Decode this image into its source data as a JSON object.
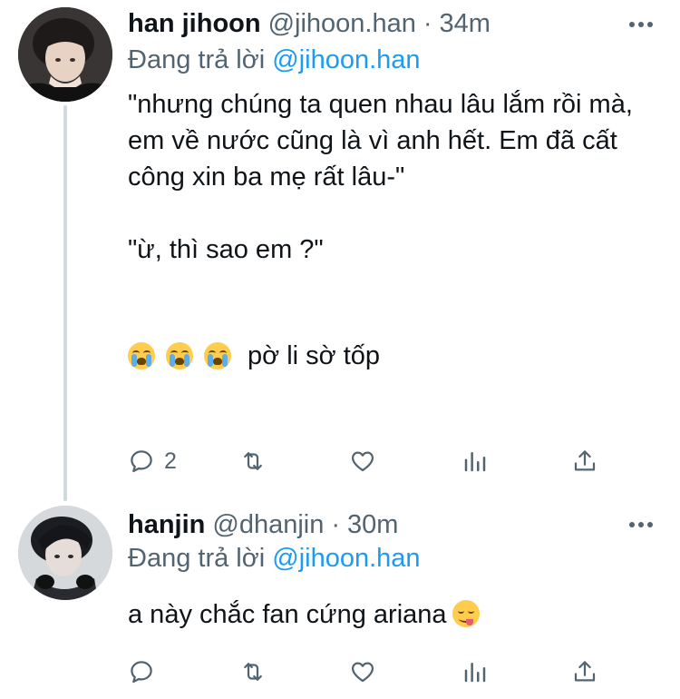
{
  "tweets": [
    {
      "display_name": "han jihoon",
      "handle": "@jihoon.han",
      "separator": "·",
      "time": "34m",
      "reply_prefix": "Đang trả lời",
      "reply_mention": "@jihoon.han",
      "text": "\"nhưng chúng ta quen nhau lâu lắm rồi mà, em về nước cũng là vì anh hết. Em đã cất công xin ba mẹ rất lâu-\"\n\n\"ừ, thì sao em ?\"",
      "emoji_text": "pờ li sờ tốp",
      "emojis": [
        "loudly-crying-face",
        "loudly-crying-face",
        "loudly-crying-face"
      ],
      "reply_count": "2"
    },
    {
      "display_name": "hanjin",
      "handle": "@dhanjin",
      "separator": "·",
      "time": "30m",
      "reply_prefix": "Đang trả lời",
      "reply_mention": "@jihoon.han",
      "text": "a này chắc fan cứng ariana",
      "emojis": [
        "face-savoring-food"
      ]
    }
  ],
  "colors": {
    "text_primary": "#0f1419",
    "text_secondary": "#536471",
    "accent": "#1d9bf0",
    "thread_line": "#cfd9de"
  }
}
